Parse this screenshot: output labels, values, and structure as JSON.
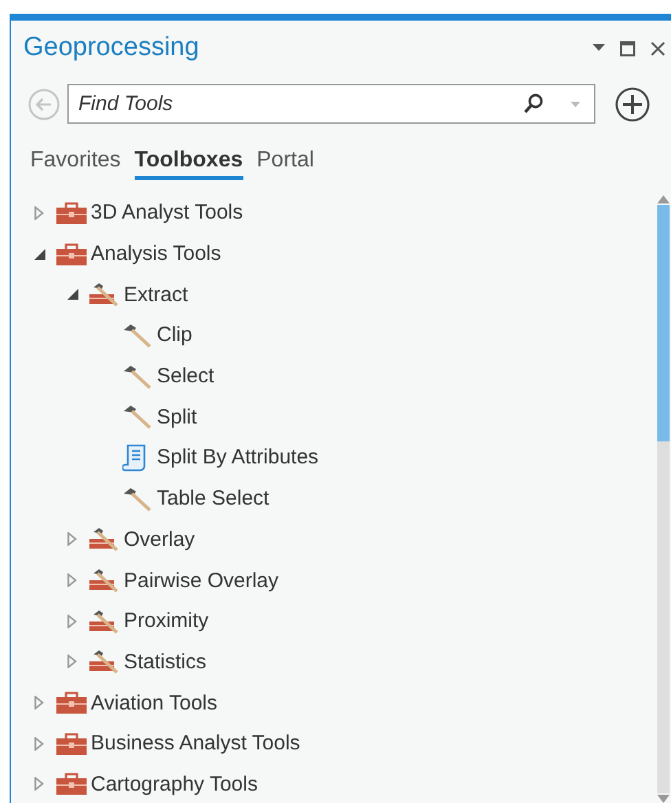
{
  "window": {
    "title": "Geoprocessing"
  },
  "search": {
    "placeholder": "Find Tools"
  },
  "tabs": [
    {
      "label": "Favorites",
      "selected": false
    },
    {
      "label": "Toolboxes",
      "selected": true
    },
    {
      "label": "Portal",
      "selected": false
    }
  ],
  "tree": [
    {
      "kind": "toolbox",
      "label": "3D Analyst Tools",
      "expanded": false
    },
    {
      "kind": "toolbox",
      "label": "Analysis Tools",
      "expanded": true,
      "children": [
        {
          "kind": "toolset",
          "label": "Extract",
          "expanded": true,
          "children": [
            {
              "kind": "tool",
              "label": "Clip"
            },
            {
              "kind": "tool",
              "label": "Select"
            },
            {
              "kind": "tool",
              "label": "Split"
            },
            {
              "kind": "script",
              "label": "Split By Attributes"
            },
            {
              "kind": "tool",
              "label": "Table Select"
            }
          ]
        },
        {
          "kind": "toolset",
          "label": "Overlay",
          "expanded": false
        },
        {
          "kind": "toolset",
          "label": "Pairwise Overlay",
          "expanded": false
        },
        {
          "kind": "toolset",
          "label": "Proximity",
          "expanded": false
        },
        {
          "kind": "toolset",
          "label": "Statistics",
          "expanded": false
        }
      ]
    },
    {
      "kind": "toolbox",
      "label": "Aviation Tools",
      "expanded": false
    },
    {
      "kind": "toolbox",
      "label": "Business Analyst Tools",
      "expanded": false
    },
    {
      "kind": "toolbox",
      "label": "Cartography Tools",
      "expanded": false
    }
  ]
}
